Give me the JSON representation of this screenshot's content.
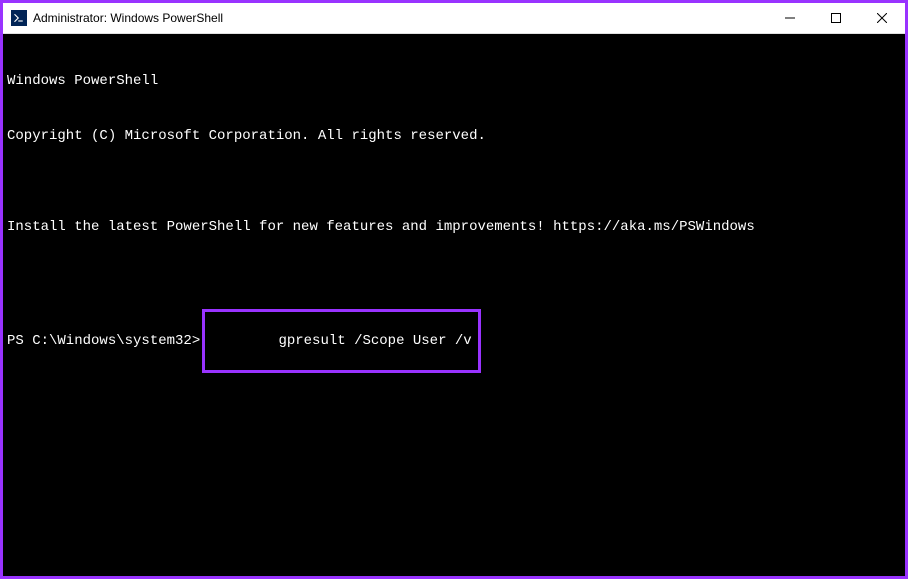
{
  "window": {
    "title": "Administrator: Windows PowerShell"
  },
  "terminal": {
    "line1": "Windows PowerShell",
    "line2": "Copyright (C) Microsoft Corporation. All rights reserved.",
    "line3": "",
    "line4": "Install the latest PowerShell for new features and improvements! https://aka.ms/PSWindows",
    "line5": "",
    "prompt": "PS C:\\Windows\\system32>",
    "command": "gpresult /Scope User /v"
  }
}
